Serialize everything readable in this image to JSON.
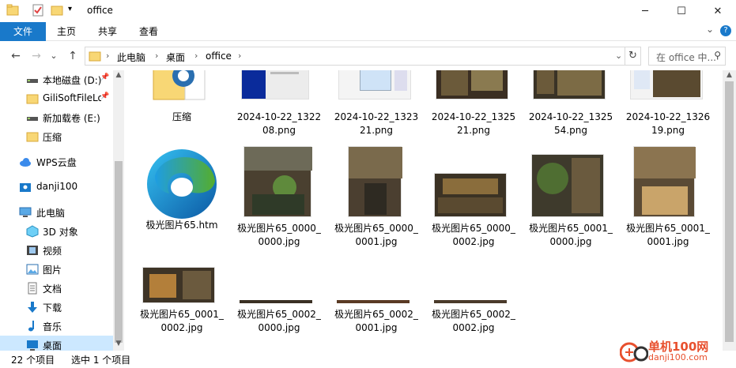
{
  "window": {
    "title": "office",
    "minimize_label": "─",
    "maximize_label": "☐",
    "close_label": "✕"
  },
  "ribbon": {
    "tabs": [
      "文件",
      "主页",
      "共享",
      "查看"
    ],
    "collapse_glyph": "⌄",
    "help_glyph": "?"
  },
  "address": {
    "back_glyph": "←",
    "forward_glyph": "→",
    "recent_glyph": "⌄",
    "up_glyph": "↑",
    "crumbs": [
      "此电脑",
      "桌面",
      "office"
    ],
    "sep_glyph": "›",
    "dropdown_glyph": "⌄",
    "refresh_glyph": "↻",
    "search_placeholder": "在 office 中...",
    "search_glyph": "⚲"
  },
  "sidebar": {
    "items": [
      {
        "label": "本地磁盘 (D:)",
        "icon": "drive-icon",
        "pinned": true
      },
      {
        "label": "GiliSoftFileLo",
        "icon": "folder-icon",
        "pinned": true
      },
      {
        "label": "新加载卷 (E:)",
        "icon": "drive-icon",
        "pinned": false
      },
      {
        "label": "压缩",
        "icon": "folder-icon",
        "pinned": false
      },
      {
        "label": "WPS云盘",
        "icon": "cloud-icon",
        "pinned": false
      },
      {
        "label": "danji100",
        "icon": "user-folder-icon",
        "pinned": false
      },
      {
        "label": "此电脑",
        "icon": "computer-icon",
        "pinned": false
      },
      {
        "label": "3D 对象",
        "icon": "3d-objects-icon",
        "pinned": false
      },
      {
        "label": "视频",
        "icon": "video-icon",
        "pinned": false
      },
      {
        "label": "图片",
        "icon": "pictures-icon",
        "pinned": false
      },
      {
        "label": "文档",
        "icon": "documents-icon",
        "pinned": false
      },
      {
        "label": "下载",
        "icon": "download-icon",
        "pinned": false
      },
      {
        "label": "音乐",
        "icon": "music-icon",
        "pinned": false
      },
      {
        "label": "桌面",
        "icon": "desktop-icon",
        "pinned": false
      }
    ],
    "pin_glyph": "📌"
  },
  "files": [
    {
      "name": "压缩",
      "kind": "folder"
    },
    {
      "name": "2024-10-22_132208.png",
      "kind": "screenshot"
    },
    {
      "name": "2024-10-22_132321.png",
      "kind": "screenshot"
    },
    {
      "name": "2024-10-22_132521.png",
      "kind": "photo"
    },
    {
      "name": "2024-10-22_132554.png",
      "kind": "photo"
    },
    {
      "name": "2024-10-22_132619.png",
      "kind": "screenshot"
    },
    {
      "name": "极光图片65.htm",
      "kind": "edge"
    },
    {
      "name": "极光图片65_0000_0000.jpg",
      "kind": "photo"
    },
    {
      "name": "极光图片65_0000_0001.jpg",
      "kind": "photo"
    },
    {
      "name": "极光图片65_0000_0002.jpg",
      "kind": "photo"
    },
    {
      "name": "极光图片65_0001_0000.jpg",
      "kind": "photo"
    },
    {
      "name": "极光图片65_0001_0001.jpg",
      "kind": "photo"
    },
    {
      "name": "极光图片65_0001_0002.jpg",
      "kind": "photo"
    },
    {
      "name": "极光图片65_0002_0000.jpg",
      "kind": "strip"
    },
    {
      "name": "极光图片65_0002_0001.jpg",
      "kind": "strip"
    },
    {
      "name": "极光图片65_0002_0002.jpg",
      "kind": "strip"
    }
  ],
  "status": {
    "count": "22 个项目",
    "selected": "选中 1 个项目"
  },
  "watermark": {
    "text": "单机100网",
    "url": "danji100.com"
  },
  "colors": {
    "accent": "#1979ca",
    "selection": "#cce8ff",
    "folder": "#f8d775",
    "watermark": "#e8502e"
  }
}
